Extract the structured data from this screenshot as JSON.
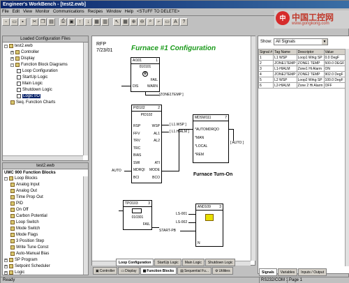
{
  "window": {
    "title": "Engineer's WorkBench - [test2.ewb]"
  },
  "menu": [
    "File",
    "Edit",
    "View",
    "Monitor",
    "Communications",
    "Recipes",
    "Window",
    "Help",
    "<STUFF TO DELETE>"
  ],
  "watermark": {
    "logo": "中",
    "text": "中国工控网",
    "url": "www.gongkong.com"
  },
  "config_panel": {
    "title": "Loaded Configuration Files",
    "items": [
      {
        "label": "test2.ewb",
        "level": 1,
        "expander": "-"
      },
      {
        "label": "Controller",
        "level": 2,
        "expander": "+"
      },
      {
        "label": "Display",
        "level": 2,
        "expander": "+"
      },
      {
        "label": "Function Block Diagrams",
        "level": 2,
        "expander": "-"
      },
      {
        "label": "Loop Configuration",
        "level": 3
      },
      {
        "label": "StartUp Logic",
        "level": 3
      },
      {
        "label": "Main Logic",
        "level": 3
      },
      {
        "label": "Shutdown Logic",
        "level": 3
      },
      {
        "label": "Logic I/O",
        "level": 3,
        "selected": true
      },
      {
        "label": "Seq. Function Charts",
        "level": 2
      }
    ]
  },
  "library_panel": {
    "file": "test2.ewb",
    "title": "UMC 900 Function Blocks",
    "items": [
      {
        "label": "Loop Blocks",
        "level": 1,
        "expander": "-"
      },
      {
        "label": "Analog Input",
        "level": 2
      },
      {
        "label": "Analog Out",
        "level": 2
      },
      {
        "label": "Time Prop Out",
        "level": 2
      },
      {
        "label": "PID",
        "level": 2
      },
      {
        "label": "On Off",
        "level": 2
      },
      {
        "label": "Carbon Potential",
        "level": 2
      },
      {
        "label": "Loop Switch",
        "level": 2
      },
      {
        "label": "Mode Switch",
        "level": 2
      },
      {
        "label": "Mode Flags",
        "level": 2
      },
      {
        "label": "3 Position Step",
        "level": 2
      },
      {
        "label": "Write Tune Const",
        "level": 2
      },
      {
        "label": "Auto-Manual Bias",
        "level": 2
      },
      {
        "label": "SP Program",
        "level": 1,
        "expander": "+"
      },
      {
        "label": "Setpoint Scheduler",
        "level": 1,
        "expander": "+"
      },
      {
        "label": "Logic",
        "level": 1,
        "expander": "+"
      }
    ]
  },
  "diagram": {
    "header_left": "RFP",
    "header_date": "7/23/01",
    "title": "Furnace #1 Configuration",
    "subtitle": "Furnace Turn-On",
    "blocks": {
      "ai": {
        "name": "AI101",
        "num": "1",
        "tag": "010101",
        "pins_right": [
          "FAIL",
          "WARN"
        ],
        "pins_left": [
          "DIS"
        ],
        "out_label": "[ZONE1TEMP ]"
      },
      "pid": {
        "name": "PID102",
        "num": "2",
        "tag": "PID102",
        "pins_left": [
          "RSP",
          "FFV",
          "TRV",
          "TRC",
          "BIAS",
          "SWI",
          "MDRQI",
          "BCI"
        ],
        "pins_right": [
          "WSP",
          "AL1",
          "AL2",
          "",
          "",
          "ATI",
          "MODE",
          "BCO"
        ],
        "labels_right": [
          "[ L1.WSP ]",
          "[ L1.HIALM ]"
        ]
      },
      "tpo": {
        "name": "TPO103",
        "num": "3",
        "tag": "010301",
        "pins_right": [
          "FAIL"
        ]
      },
      "mdsw": {
        "name": "MDSW111",
        "num": "7",
        "pins_left": [
          "*AUTOMDRQO",
          "*MAN",
          "*LOCAL",
          "*REM"
        ],
        "out_label": "[ AUTO ]"
      },
      "and": {
        "name": "AND109",
        "num": "3",
        "pins_left": [
          "",
          "",
          "",
          "N"
        ]
      }
    },
    "inputs": {
      "auto": "AUTO",
      "ls001": "LS-001",
      "ls002": "LS-002",
      "start": "START-PB"
    }
  },
  "diagram_tabs": [
    "Loop Configuration",
    "StartUp Logic",
    "Main Logic",
    "Shutdown Logic"
  ],
  "bottom_tabs": [
    "Controller",
    "Display",
    "Function Blocks",
    "Sequential Fu...",
    "Utilities"
  ],
  "signals_panel": {
    "show_label": "Show:",
    "show_value": "All Signals",
    "columns": [
      "Signal #",
      "Tag Name",
      "Descriptor",
      "Value"
    ],
    "rows": [
      [
        "1",
        "L1 WSP",
        "Loop1 Wrkg SP",
        "0.0 DegF"
      ],
      [
        "2",
        "ZONE1TEMP",
        "ZONE1 TEMP",
        "500.0 DEGF"
      ],
      [
        "3",
        "L1-HIALM",
        "Zone1 Hi Alarm",
        "ON"
      ],
      [
        "4",
        "ZONE2TEMP",
        "ZONE2 TEMP",
        "902.0 DegF"
      ],
      [
        "5",
        "L2 WSP",
        "Loop2 Wrkg SP",
        "100.0 DegF"
      ],
      [
        "6",
        "L2-HIALM",
        "Zone 2 Hi Alarm",
        "OFF"
      ]
    ],
    "tabs": [
      "Signals",
      "Variables",
      "Inputs / Output"
    ]
  },
  "status": {
    "left": "Ready",
    "port": "RS232/COM 1",
    "page": "Page 1"
  }
}
